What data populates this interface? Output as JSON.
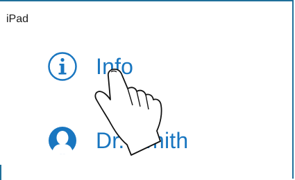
{
  "device": {
    "label": "iPad"
  },
  "menu": {
    "info": {
      "label": "Info",
      "icon": "info-icon"
    },
    "doctor": {
      "label": "Dr. Smith",
      "icon": "person-avatar-icon"
    }
  },
  "overlay": {
    "icon": "tap-hand-icon"
  },
  "colors": {
    "accent": "#1976c0",
    "frame": "#1f6f9a",
    "text": "#1a1a1a"
  }
}
